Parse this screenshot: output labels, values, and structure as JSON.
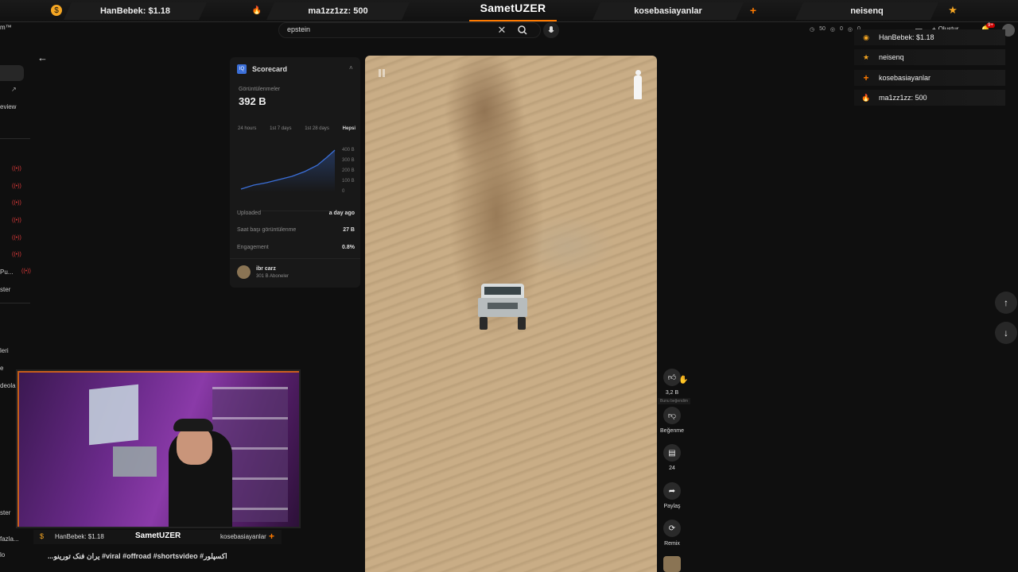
{
  "stream_bar": {
    "brand": "SametUZER",
    "items": [
      {
        "label": "HanBebek: $1.18",
        "icon": "coin-icon"
      },
      {
        "label": "ma1zz1zz: 500",
        "icon": "flame-icon"
      },
      {
        "label": "kosebasiayanlar",
        "icon": "plus-icon"
      },
      {
        "label": "neisenq",
        "icon": "star-icon"
      }
    ]
  },
  "header": {
    "search_value": "epstein",
    "create_label": "Oluştur",
    "notif_count": "9+",
    "stats": [
      "50",
      "0",
      "0"
    ]
  },
  "sidebar": {
    "items": [
      "eview",
      "Pu...",
      "ster",
      "leri",
      "e",
      "deola...",
      "ster",
      "fazla...",
      "lo"
    ]
  },
  "scorecard": {
    "title": "Scorecard",
    "views_label": "Görüntülenmeler",
    "views_value": "392 B",
    "ranges": [
      "24 hours",
      "1st 7 days",
      "1st 28 days",
      "Hepsi"
    ],
    "active_range": "Hepsi",
    "y_ticks": [
      "400 B",
      "300 B",
      "200 B",
      "100 B",
      "0"
    ],
    "rows": [
      {
        "label": "Uploaded",
        "value": "a day ago"
      },
      {
        "label": "Saat başı görüntülenme",
        "value": "27 B"
      },
      {
        "label": "Engagement",
        "value": "0.8%"
      }
    ],
    "channel_name": "ibr carz",
    "channel_subs": "301 B Aboneler"
  },
  "actions": {
    "like_count": "3,2 B",
    "dislike_label": "Beğenme",
    "comment_count": "24",
    "share_label": "Paylaş",
    "remix_label": "Remix",
    "tooltip": "Bunu beğendim"
  },
  "overlay_list": [
    {
      "label": "HanBebek: $1.18",
      "icon": "coin-icon",
      "color": "#f5a623"
    },
    {
      "label": "neisenq",
      "icon": "star-icon",
      "color": "#f5a623"
    },
    {
      "label": "kosebasiayanlar",
      "icon": "plus-icon",
      "color": "#ff7a00"
    },
    {
      "label": "ma1zz1zz: 500",
      "icon": "flame-icon",
      "color": "#ff9a00"
    }
  ],
  "cam_bar": {
    "left": "HanBebek: $1.18",
    "brand": "SametUZER",
    "right": "kosebasiayanlar"
  },
  "caption": "...یران فنک تورینو #viral #offroad #shortsvideo #اکسپلور",
  "colors": {
    "accent": "#ff7a00",
    "chart_line": "#3b6fd8"
  }
}
